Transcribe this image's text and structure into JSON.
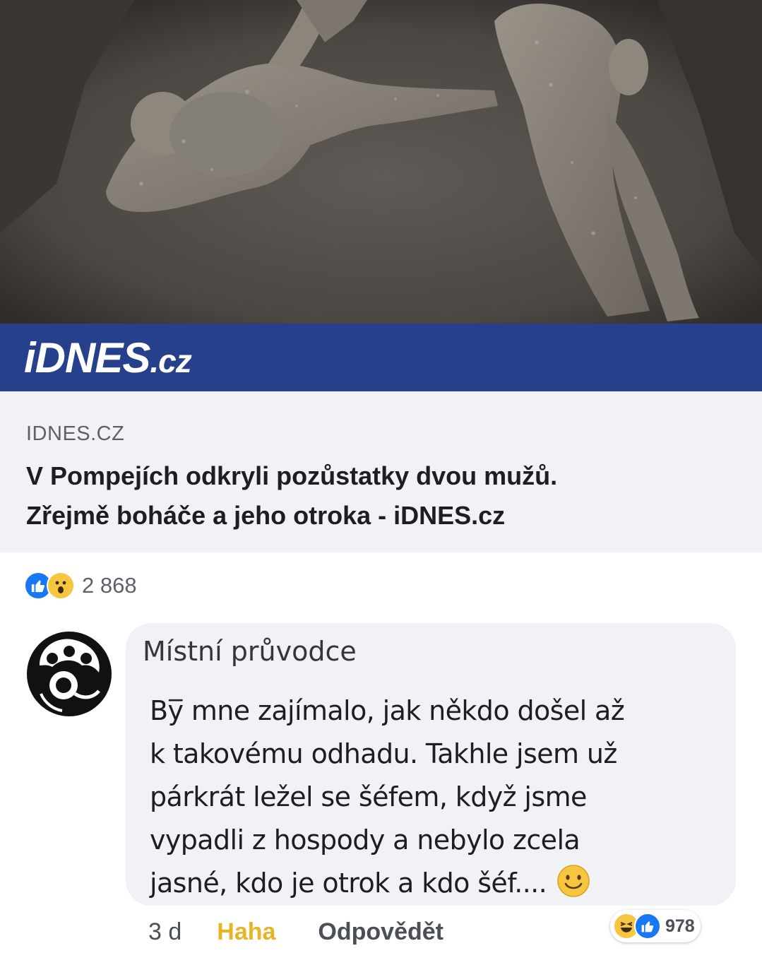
{
  "preview_image": {
    "brand_logo_main": "iDNES",
    "brand_logo_suffix": ".cz",
    "brand_color": "#27408b"
  },
  "link": {
    "domain": "IDNES.CZ",
    "title_line1": "V Pompejích odkryli pozůstatky dvou mužů.",
    "title_line2": "Zřejmě boháče a jeho otroka - iDNES.cz"
  },
  "post_reactions": {
    "icons": [
      "like-icon",
      "wow-icon"
    ],
    "count": "2 868"
  },
  "comment": {
    "author": "Místní průvodce",
    "lines": [
      "By̅ mne zajímalo, jak někdo došel až",
      "k takovému odhadu. Takhle jsem už",
      "párkrát ležel se šéfem, když jsme",
      "vypadli z hospody a nebylo zcela",
      "jasné, kdo je otrok a kdo šéf...."
    ],
    "emoji": "smile-emoji",
    "time": "3 d",
    "reaction_label": "Haha",
    "reply_label": "Odpovědět",
    "reactions": {
      "icons": [
        "haha-icon",
        "like-icon"
      ],
      "count": "978"
    }
  },
  "colors": {
    "facebook_blue": "#1877f2",
    "haha_yellow": "#e6b526",
    "bubble_bg": "#f0f2f5"
  }
}
